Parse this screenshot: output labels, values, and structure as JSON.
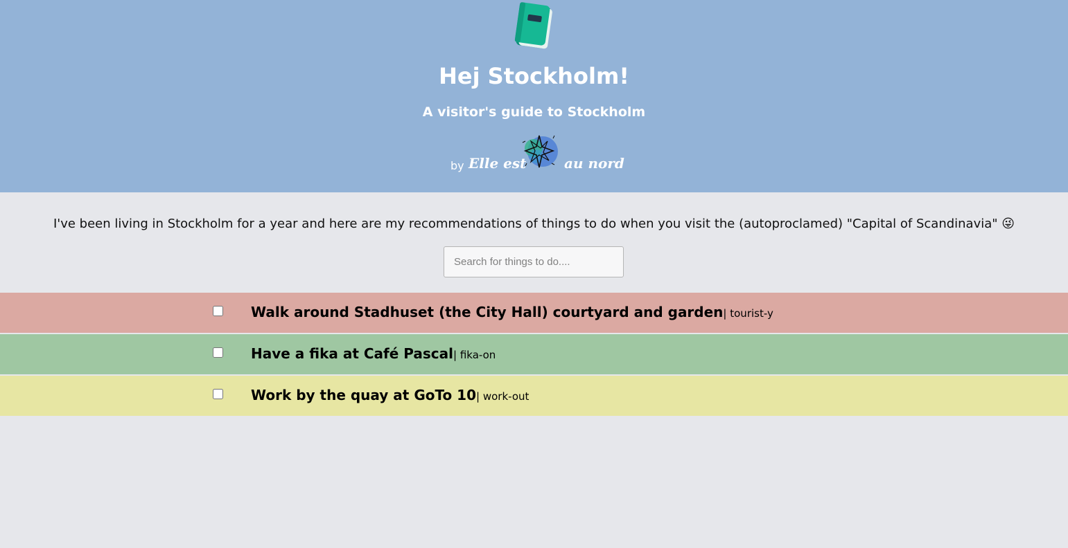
{
  "header": {
    "title": "Hej Stockholm!",
    "subtitle": "A visitor's guide to Stockholm",
    "by_label": "by",
    "brand_left": "Elle est",
    "brand_right": "au nord",
    "background": "#93b3d7",
    "icon": "book-icon",
    "logo": "compass-logo"
  },
  "intro": {
    "text": "I've been living in Stockholm for a year and here are my recommendations of things to do when you visit the (autoproclamed) \"Capital of Scandinavia\" 😜"
  },
  "search": {
    "placeholder": "Search for things to do....",
    "value": ""
  },
  "items": [
    {
      "title": "Walk around Stadhuset (the City Hall) courtyard and garden",
      "separator": "| ",
      "tag": "tourist-y",
      "color": "#dba9a2",
      "checked": false
    },
    {
      "title": "Have a fika at Café Pascal",
      "separator": "| ",
      "tag": "fika-on",
      "color": "#9fc7a2",
      "checked": false
    },
    {
      "title": "Work by the quay at GoTo 10",
      "separator": "| ",
      "tag": "work-out",
      "color": "#e7e6a3",
      "checked": false
    }
  ]
}
